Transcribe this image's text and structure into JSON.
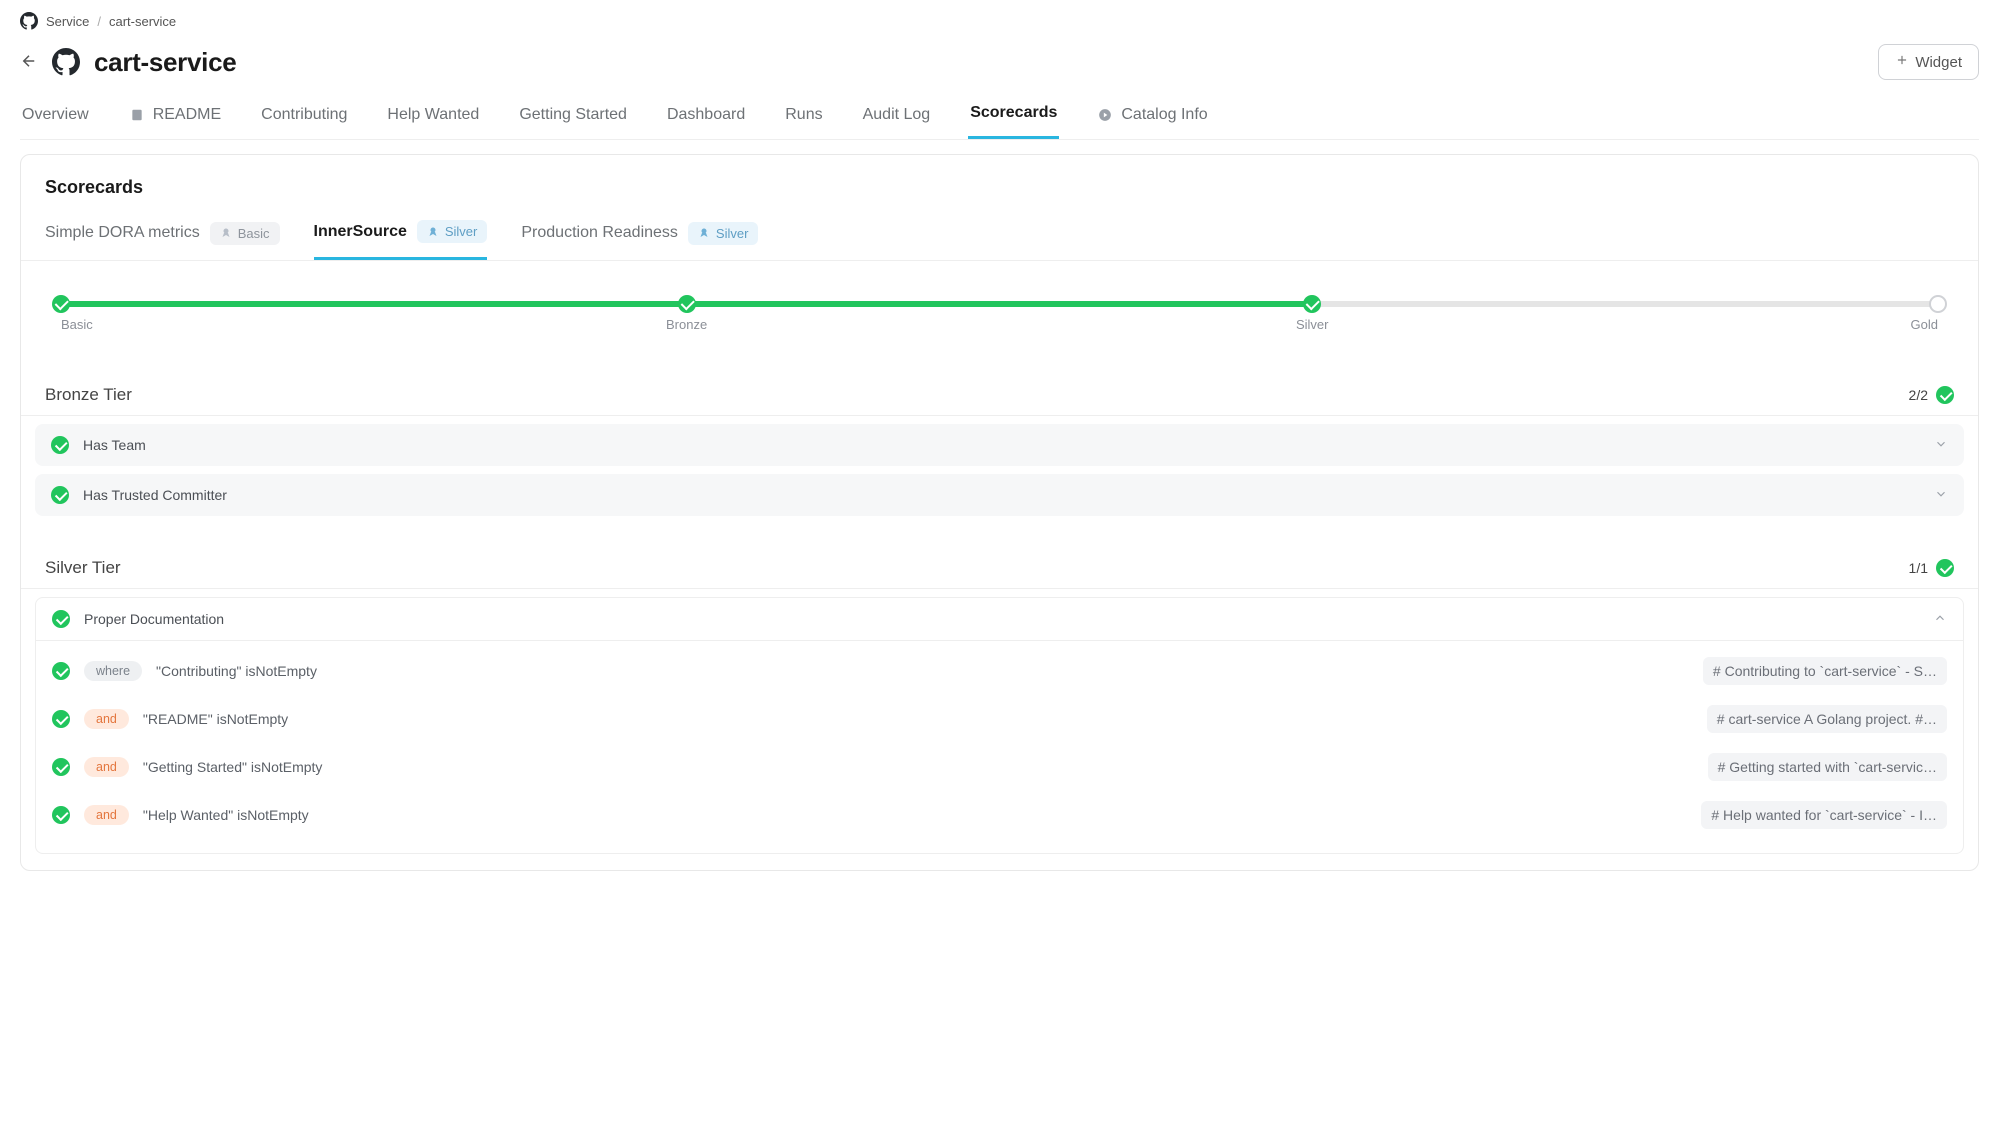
{
  "breadcrumb": {
    "level1": "Service",
    "level2": "cart-service"
  },
  "pageTitle": "cart-service",
  "widgetButton": "Widget",
  "mainTabs": [
    {
      "label": "Overview"
    },
    {
      "label": "README"
    },
    {
      "label": "Contributing"
    },
    {
      "label": "Help Wanted"
    },
    {
      "label": "Getting Started"
    },
    {
      "label": "Dashboard"
    },
    {
      "label": "Runs"
    },
    {
      "label": "Audit Log"
    },
    {
      "label": "Scorecards"
    },
    {
      "label": "Catalog Info"
    }
  ],
  "scorecards": {
    "title": "Scorecards",
    "tabs": [
      {
        "label": "Simple DORA metrics",
        "badge": "Basic",
        "badgeStyle": "gray"
      },
      {
        "label": "InnerSource",
        "badge": "Silver",
        "badgeStyle": "blue"
      },
      {
        "label": "Production Readiness",
        "badge": "Silver",
        "badgeStyle": "blue"
      }
    ],
    "activeIndex": 1
  },
  "progress": {
    "percent": 66.6,
    "steps": [
      {
        "label": "Basic",
        "pos": 0,
        "done": true
      },
      {
        "label": "Bronze",
        "pos": 33.33,
        "done": true
      },
      {
        "label": "Silver",
        "pos": 66.66,
        "done": true
      },
      {
        "label": "Gold",
        "pos": 100,
        "done": false
      }
    ]
  },
  "tiers": [
    {
      "name": "Bronze Tier",
      "count": "2/2",
      "rules": [
        {
          "label": "Has Team"
        },
        {
          "label": "Has Trusted Committer"
        }
      ]
    },
    {
      "name": "Silver Tier",
      "count": "1/1",
      "expandedRule": {
        "label": "Proper Documentation",
        "conditions": [
          {
            "op": "where",
            "text": "\"Contributing\" isNotEmpty",
            "preview": "# Contributing to `cart-service` - S…"
          },
          {
            "op": "and",
            "text": "\"README\" isNotEmpty",
            "preview": "# cart-service A Golang project. #…"
          },
          {
            "op": "and",
            "text": "\"Getting Started\" isNotEmpty",
            "preview": "# Getting started with `cart-servic…"
          },
          {
            "op": "and",
            "text": "\"Help Wanted\" isNotEmpty",
            "preview": "# Help wanted for `cart-service` - I…"
          }
        ]
      }
    }
  ]
}
